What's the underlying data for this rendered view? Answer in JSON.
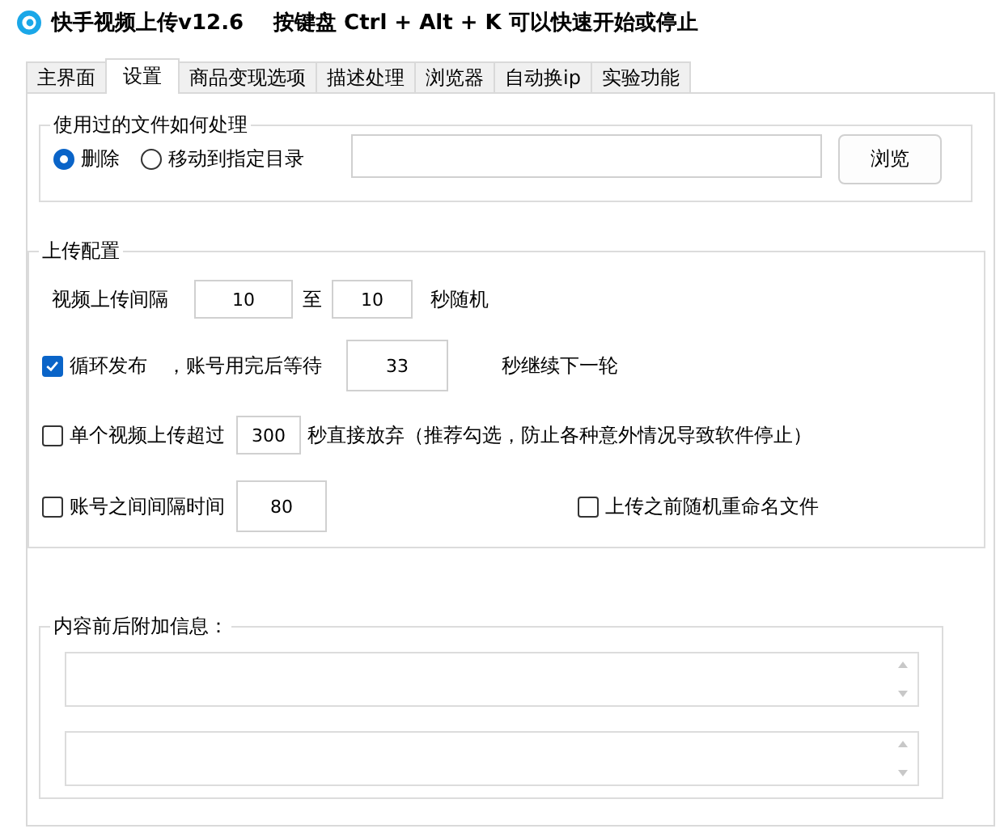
{
  "window": {
    "title": "快手视频上传v12.6",
    "hotkey_hint": "按键盘 Ctrl + Alt + K  可以快速开始或停止"
  },
  "tabs": [
    {
      "label": "主界面",
      "selected": false
    },
    {
      "label": "设置",
      "selected": true
    },
    {
      "label": "商品变现选项",
      "selected": false
    },
    {
      "label": "描述处理",
      "selected": false
    },
    {
      "label": "浏览器",
      "selected": false
    },
    {
      "label": "自动换ip",
      "selected": false
    },
    {
      "label": "实验功能",
      "selected": false
    }
  ],
  "file_handling": {
    "title": "使用过的文件如何处理",
    "options": [
      {
        "label": "删除",
        "selected": true
      },
      {
        "label": "移动到指定目录",
        "selected": false
      }
    ],
    "browse_button": "浏览"
  },
  "upload_config": {
    "title": "上传配置",
    "interval": {
      "label": "视频上传间隔",
      "min": "10",
      "to": "至",
      "max": "10",
      "suffix": "秒随机"
    },
    "loop": {
      "label": "循环发布",
      "checked": true,
      "wait_label": "，账号用完后等待",
      "value": "33",
      "suffix": "秒继续下一轮"
    },
    "timeout": {
      "label": "单个视频上传超过",
      "checked": false,
      "value": "300",
      "suffix": "秒直接放弃（推荐勾选，防止各种意外情况导致软件停止）"
    },
    "account_gap": {
      "label": "账号之间间隔时间",
      "checked": false,
      "value": "80"
    },
    "rename": {
      "label": "上传之前随机重命名文件",
      "checked": false
    }
  },
  "extra_info": {
    "title": "内容前后附加信息："
  }
}
